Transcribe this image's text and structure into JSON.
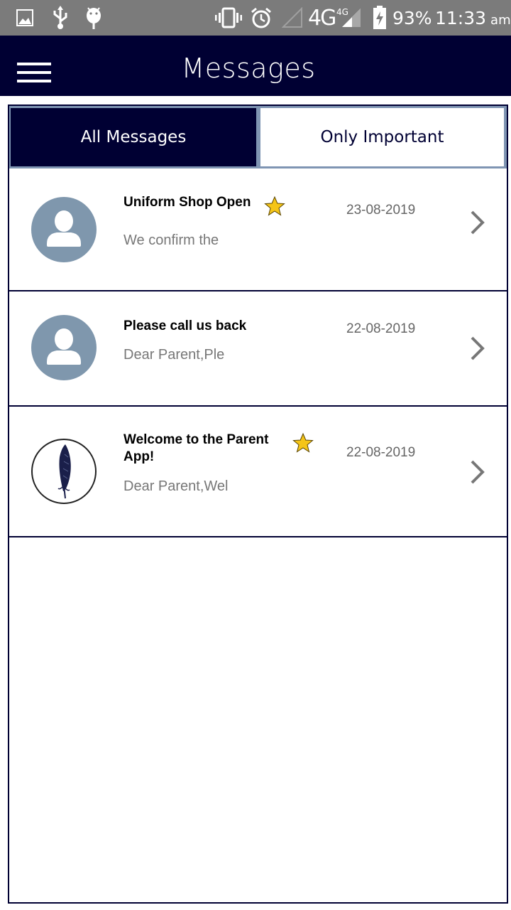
{
  "status_bar": {
    "battery": "93%",
    "time": "11:33",
    "time_suffix": "am",
    "network": "4G",
    "network_small": "4G",
    "icons": [
      "image-icon",
      "usb-icon",
      "android-debug-icon",
      "vibrate-icon",
      "alarm-icon",
      "signal-empty-icon",
      "signal-icon",
      "battery-charging-icon"
    ]
  },
  "app_bar": {
    "title": "Messages",
    "menu_icon": "hamburger-menu-icon"
  },
  "tabs": [
    {
      "label": "All Messages",
      "selected": true
    },
    {
      "label": "Only Important",
      "selected": false
    }
  ],
  "messages": [
    {
      "title": "Uniform Shop Open",
      "preview": "We confirm the",
      "date": "23-08-2019",
      "important": true,
      "avatar": "default-user-avatar"
    },
    {
      "title": "Please call us back",
      "preview": "Dear Parent,Ple",
      "date": "22-08-2019",
      "important": false,
      "avatar": "default-user-avatar"
    },
    {
      "title_line1": "Welcome to the Parent",
      "title_line2": "App!",
      "preview": "Dear Parent,Wel",
      "date": "22-08-2019",
      "important": true,
      "avatar": "feather-logo-avatar"
    }
  ],
  "colors": {
    "primary": "#000033",
    "tab_border": "#7f95b3",
    "avatar_gray": "#7f97ad",
    "star": "#f5c518",
    "status_bar": "#7b7b7b"
  }
}
